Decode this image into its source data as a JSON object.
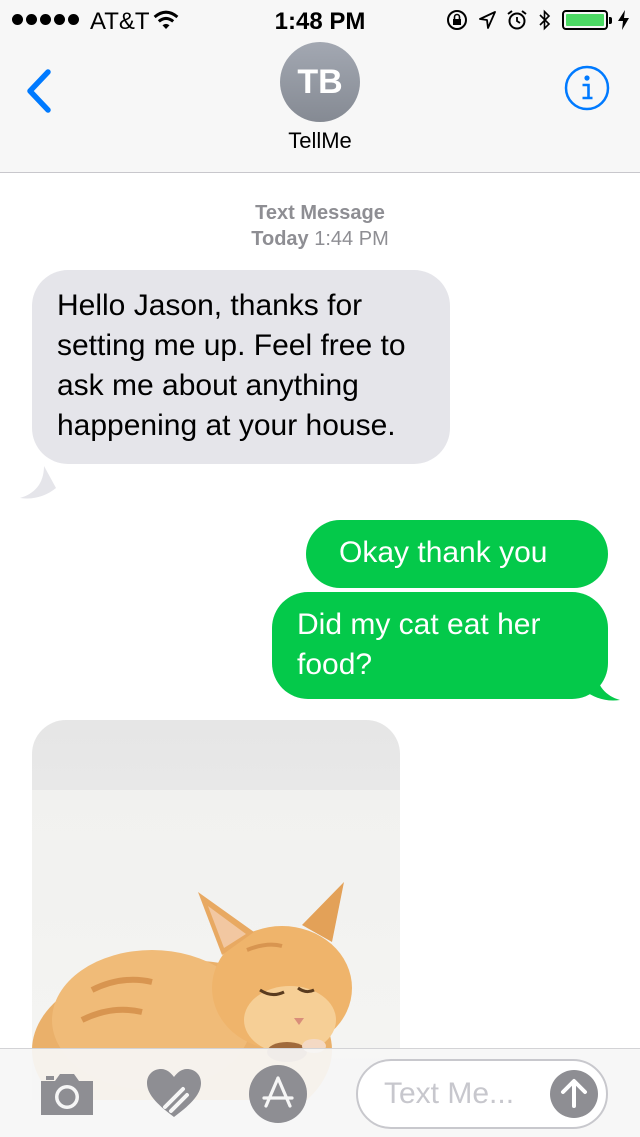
{
  "status_bar": {
    "carrier": "AT&T",
    "time": "1:48 PM",
    "battery_level": 1.0,
    "icons": [
      "signal-dots-icon",
      "wifi-icon",
      "orientation-lock-icon",
      "location-icon",
      "alarm-icon",
      "bluetooth-icon",
      "battery-icon",
      "charging-icon"
    ]
  },
  "header": {
    "back_icon": "chevron-left-icon",
    "avatar_initials": "TB",
    "contact_name": "TellMe",
    "info_icon": "info-icon"
  },
  "conversation": {
    "service_label": "Text Message",
    "day": "Today",
    "time": "1:44 PM",
    "messages": [
      {
        "direction": "incoming",
        "text": "Hello Jason, thanks for setting me up. Feel free to ask me about anything happening at your house."
      },
      {
        "direction": "outgoing",
        "text": "Okay thank you"
      },
      {
        "direction": "outgoing",
        "text": "Did my cat eat her food?"
      },
      {
        "direction": "incoming",
        "type": "image",
        "subject": "orange kitten eating"
      }
    ]
  },
  "input_bar": {
    "camera_icon": "camera-icon",
    "digital_touch_icon": "heart-touch-icon",
    "app_store_icon": "app-store-icon",
    "placeholder": "Text Me...",
    "send_icon": "arrow-up-icon"
  },
  "colors": {
    "outgoing_bubble": "#04c94a",
    "incoming_bubble": "#e5e5ea",
    "accent": "#007aff",
    "battery_fill": "#4cd964"
  }
}
